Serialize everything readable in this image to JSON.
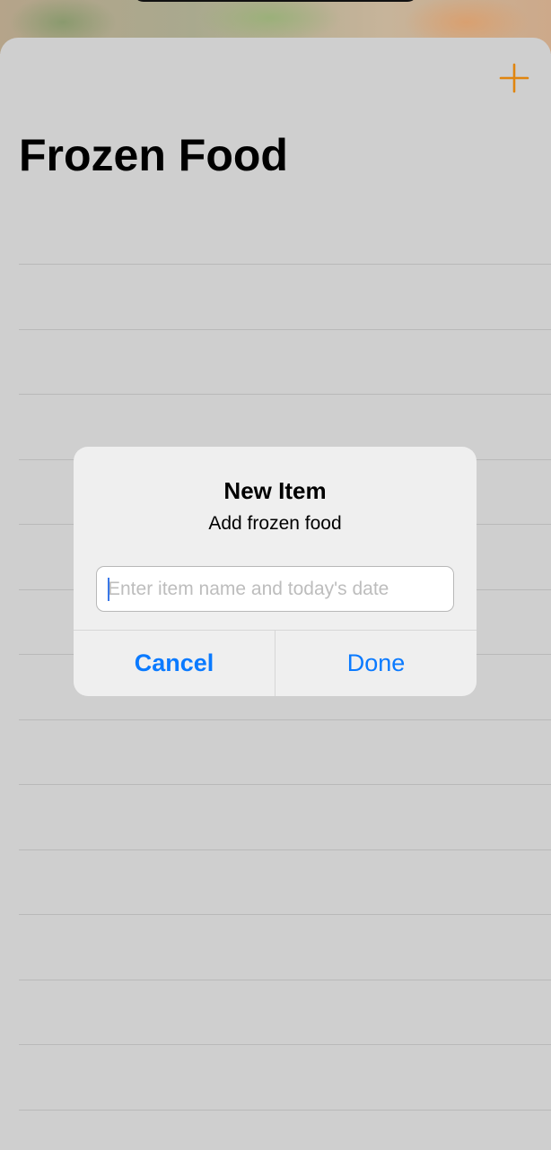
{
  "nav": {
    "title": "Frozen Food",
    "add_icon": "plus-icon",
    "accent_color": "#e0850f"
  },
  "list": {
    "row_count": 14
  },
  "alert": {
    "title": "New Item",
    "message": "Add frozen food",
    "input": {
      "value": "",
      "placeholder": "Enter item name and today's date"
    },
    "cancel_label": "Cancel",
    "done_label": "Done",
    "button_color": "#0a7aff"
  }
}
